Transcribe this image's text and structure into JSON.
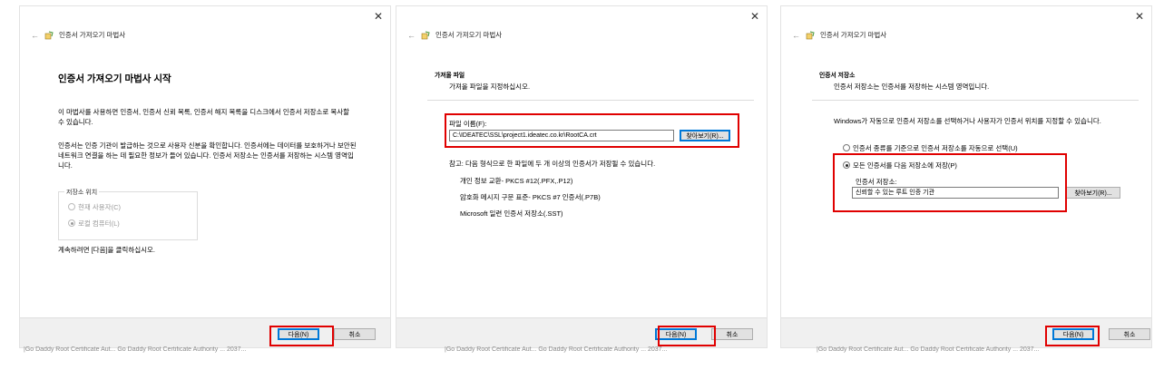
{
  "common": {
    "nav_title": "인증서 가져오기 마법사",
    "back_glyph": "←",
    "close_glyph": "✕",
    "next_label": "다음(N)",
    "cancel_label": "취소",
    "browse_label": "찾아보기(R)..."
  },
  "panel1": {
    "heading": "인증서 가져오기 마법사 시작",
    "para1": "이 마법사를 사용하면 인증서, 인증서 신뢰 목록, 인증서 해지 목록을 디스크에서 인증서 저장소로 복사할 수 있습니다.",
    "para2": "인증서는 인증 기관이 발급하는 것으로 사용자 신분을 확인합니다. 인증서에는 데이터를 보호하거나 보안된 네트워크 연결을 하는 데 필요한 정보가 들어 있습니다. 인증서 저장소는 인증서를 저장하는 시스템 영역입니다.",
    "store_group_label": "저장소 위치",
    "opt_current_user": "현재 사용자(C)",
    "opt_local_machine": "로컬 컴퓨터(L)",
    "continue_text": "계속하려면 [다음]을 클릭하십시오."
  },
  "panel2": {
    "section_title": "가져올 파일",
    "section_subtitle": "가져올 파일을 지정하십시오.",
    "file_label": "파일 이름(F):",
    "file_value": "C:\\IDEATEC\\SSL\\project1.ideatec.co.kr\\RootCA.crt",
    "note": "참고: 다음 형식으로 한 파일에 두 개 이상의 인증서가 저장될 수 있습니다.",
    "formats": [
      "개인 정보 교환- PKCS #12(.PFX,.P12)",
      "암호화 메시지 구문 표준- PKCS #7 인증서(.P7B)",
      "Microsoft 일련 인증서 저장소(.SST)"
    ]
  },
  "panel3": {
    "section_title": "인증서 저장소",
    "section_subtitle": "인증서 저장소는 인증서를 저장하는 시스템 영역입니다.",
    "desc": "Windows가 자동으로 인증서 저장소를 선택하거나 사용자가 인증서 위치를 지정할 수 있습니다.",
    "opt_auto": "인증서 종류를 기준으로 인증서 저장소를 자동으로 선택(U)",
    "opt_manual": "모든 인증서를 다음 저장소에 저장(P)",
    "store_label": "인증서 저장소:",
    "store_value": "신뢰할 수 있는 루트 인증 기관"
  },
  "background_strip": "|Go Daddy Root Certificate Aut...   Go Daddy Root Certificate Authority ...   2037..."
}
